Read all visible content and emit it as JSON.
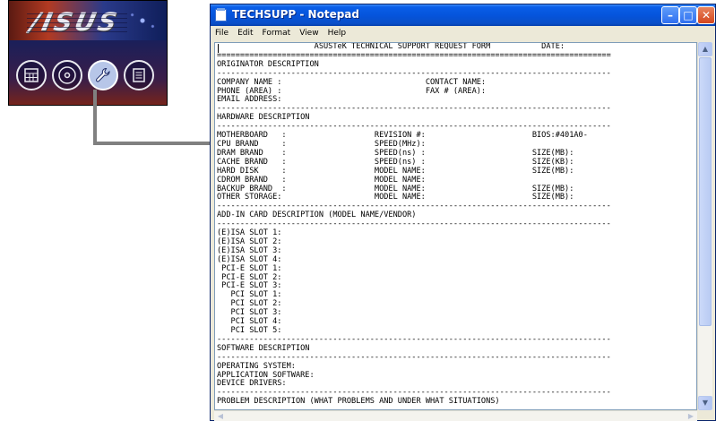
{
  "launcher": {
    "logo": "/ISUS",
    "icons": [
      {
        "name": "calculator-icon"
      },
      {
        "name": "cd-icon"
      },
      {
        "name": "wrench-icon"
      },
      {
        "name": "notes-icon"
      }
    ]
  },
  "window": {
    "title": "TECHSUPP - Notepad",
    "menu": [
      "File",
      "Edit",
      "Format",
      "View",
      "Help"
    ],
    "buttons": {
      "minimize": "–",
      "maximize": "□",
      "close": "✕"
    }
  },
  "document": {
    "lines": [
      "                     ASUSTeK TECHNICAL SUPPORT REQUEST FORM           DATE:",
      "=====================================================================================",
      "ORIGINATOR DESCRIPTION",
      "-------------------------------------------------------------------------------------",
      "COMPANY NAME :                               CONTACT NAME:",
      "PHONE (AREA) :                               FAX # (AREA):",
      "EMAIL ADDRESS:",
      "-------------------------------------------------------------------------------------",
      "HARDWARE DESCRIPTION",
      "-------------------------------------------------------------------------------------",
      "MOTHERBOARD   :                   REVISION #:                       BIOS:#401A0-",
      "CPU BRAND     :                   SPEED(MHz):",
      "DRAM BRAND    :                   SPEED(ns) :                       SIZE(MB):",
      "CACHE BRAND   :                   SPEED(ns) :                       SIZE(KB):",
      "HARD DISK     :                   MODEL NAME:                       SIZE(MB):",
      "CDROM BRAND   :                   MODEL NAME:",
      "BACKUP BRAND  :                   MODEL NAME:                       SIZE(MB):",
      "OTHER STORAGE:                    MODEL NAME:                       SIZE(MB):",
      "-------------------------------------------------------------------------------------",
      "ADD-IN CARD DESCRIPTION (MODEL NAME/VENDOR)",
      "-------------------------------------------------------------------------------------",
      "(E)ISA SLOT 1:",
      "(E)ISA SLOT 2:",
      "(E)ISA SLOT 3:",
      "(E)ISA SLOT 4:",
      " PCI-E SLOT 1:",
      " PCI-E SLOT 2:",
      " PCI-E SLOT 3:",
      "   PCI SLOT 1:",
      "   PCI SLOT 2:",
      "   PCI SLOT 3:",
      "   PCI SLOT 4:",
      "   PCI SLOT 5:",
      "-------------------------------------------------------------------------------------",
      "SOFTWARE DESCRIPTION",
      "-------------------------------------------------------------------------------------",
      "OPERATING SYSTEM:",
      "APPLICATION SOFTWARE:",
      "DEVICE DRIVERS:",
      "-------------------------------------------------------------------------------------",
      "PROBLEM DESCRIPTION (WHAT PROBLEMS AND UNDER WHAT SITUATIONS)",
      "-------------------------------------------------------------------------------------"
    ]
  }
}
